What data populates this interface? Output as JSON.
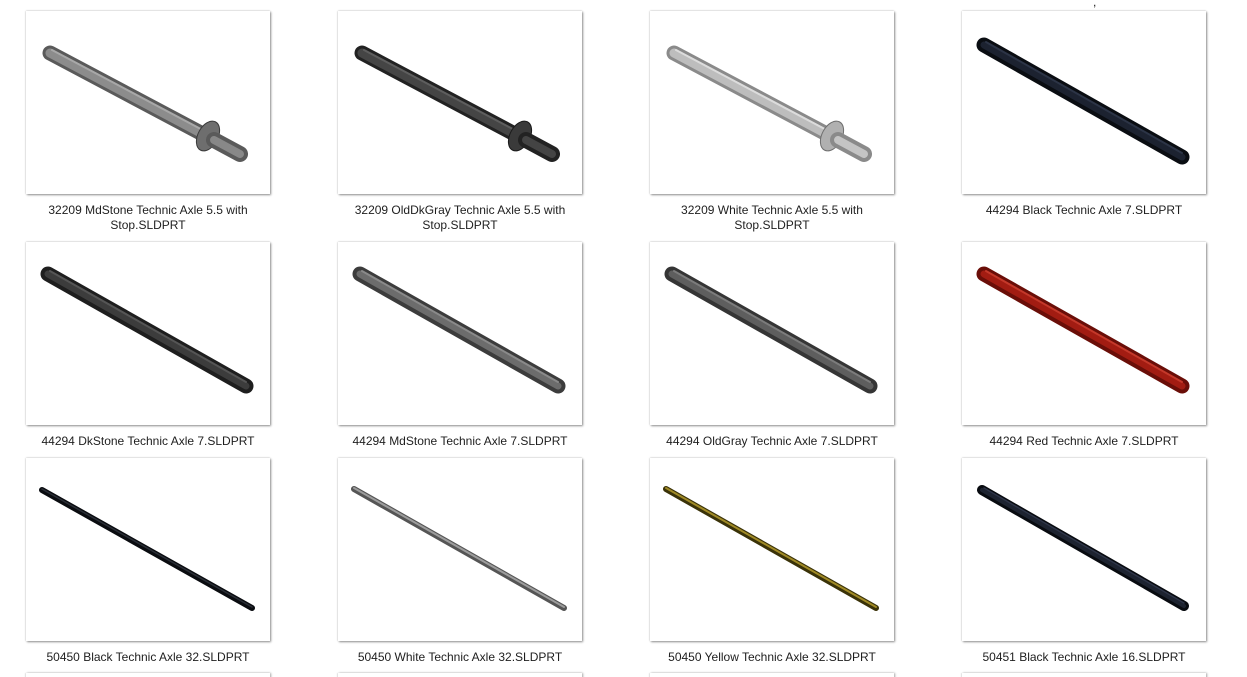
{
  "files": [
    {
      "name": "32209 MdStone Technic Axle 5.5 with Stop.SLDPRT",
      "icon": "axle-with-stop-thumbnail",
      "part_color": "#7a7a7a"
    },
    {
      "name": "32209 OldDkGray Technic Axle 5.5 with Stop.SLDPRT",
      "icon": "axle-with-stop-thumbnail",
      "part_color": "#3e3e3e"
    },
    {
      "name": "32209 White Technic Axle 5.5 with Stop.SLDPRT",
      "icon": "axle-with-stop-thumbnail",
      "part_color": "#c8c8c8"
    },
    {
      "name": "44294 Black Technic Axle 7.SLDPRT",
      "icon": "axle-thumbnail",
      "part_color": "#151a22"
    },
    {
      "name": "44294 DkStone Technic Axle 7.SLDPRT",
      "icon": "axle-thumbnail",
      "part_color": "#3a3a3a"
    },
    {
      "name": "44294 MdStone Technic Axle 7.SLDPRT",
      "icon": "axle-thumbnail",
      "part_color": "#6a6a6a"
    },
    {
      "name": "44294 OldGray Technic Axle 7.SLDPRT",
      "icon": "axle-thumbnail",
      "part_color": "#5c5c5c"
    },
    {
      "name": "44294 Red Technic Axle 7.SLDPRT",
      "icon": "axle-thumbnail",
      "part_color": "#9e1a10"
    },
    {
      "name": "50450 Black Technic Axle 32.SLDPRT",
      "icon": "long-axle-thumbnail",
      "part_color": "#15181d"
    },
    {
      "name": "50450 White Technic Axle 32.SLDPRT",
      "icon": "long-axle-thumbnail",
      "part_color": "#8a8a8a"
    },
    {
      "name": "50450 Yellow Technic Axle 32.SLDPRT",
      "icon": "long-axle-thumbnail",
      "part_color": "#8a7a20"
    },
    {
      "name": "50451 Black Technic Axle 16.SLDPRT",
      "icon": "axle-thumbnail",
      "part_color": "#14181f"
    }
  ]
}
